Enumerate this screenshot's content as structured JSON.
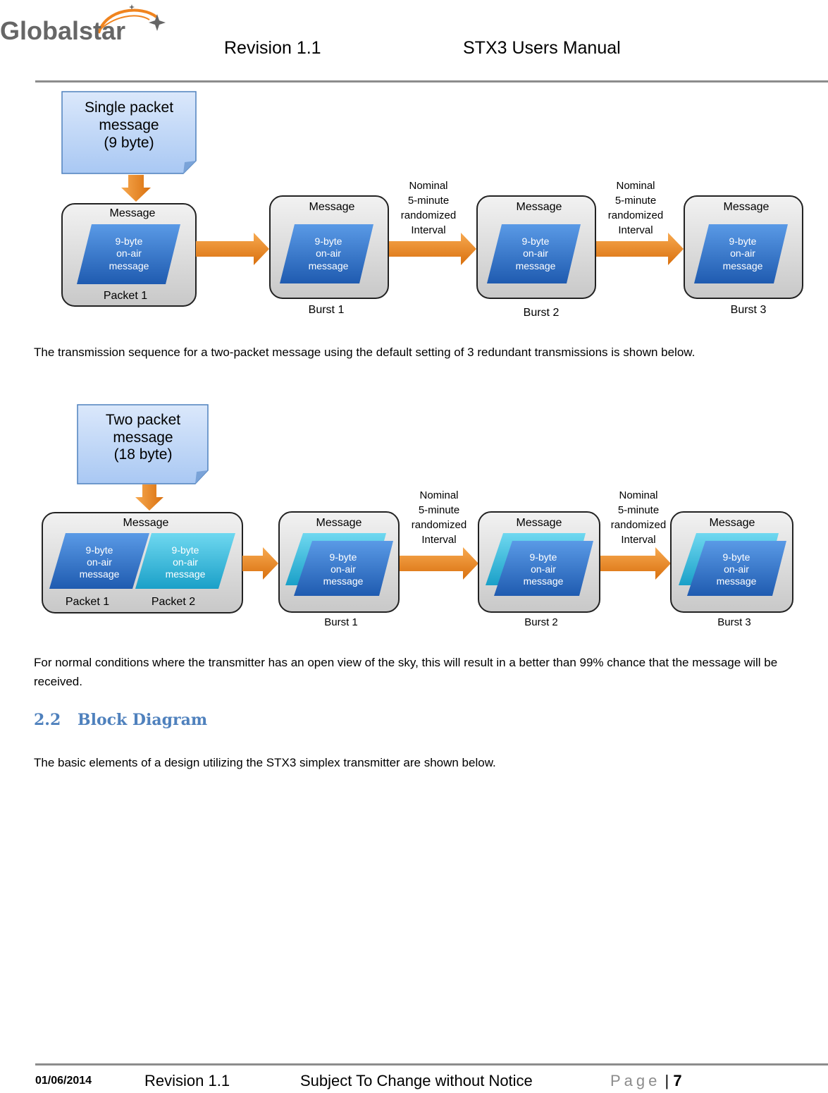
{
  "header": {
    "logo_text": "Globalstar",
    "revision": "Revision 1.1",
    "title": "STX3 Users Manual"
  },
  "diagram1": {
    "note": [
      "Single packet",
      "message",
      "(9 byte)"
    ],
    "source_box": {
      "title": "Message",
      "packets": [
        {
          "label": "Packet 1",
          "text": [
            "9-byte",
            "on-air",
            "message"
          ]
        }
      ]
    },
    "bursts": [
      {
        "title": "Message",
        "label": "Burst 1",
        "text": [
          "9-byte",
          "on-air",
          "message"
        ]
      },
      {
        "title": "Message",
        "label": "Burst 2",
        "text": [
          "9-byte",
          "on-air",
          "message"
        ]
      },
      {
        "title": "Message",
        "label": "Burst 3",
        "text": [
          "9-byte",
          "on-air",
          "message"
        ]
      }
    ],
    "interval_label": [
      "Nominal",
      "5-minute",
      "randomized",
      "Interval"
    ]
  },
  "para1": "The transmission sequence for a two-packet message using the default setting of 3 redundant transmissions is shown below.",
  "diagram2": {
    "note": [
      "Two packet",
      "message",
      "(18 byte)"
    ],
    "source_box": {
      "title": "Message",
      "packets": [
        {
          "label": "Packet 1",
          "text": [
            "9-byte",
            "on-air",
            "message"
          ]
        },
        {
          "label": "Packet 2",
          "text": [
            "9-byte",
            "on-air",
            "message"
          ]
        }
      ]
    },
    "bursts": [
      {
        "title": "Message",
        "label": "Burst 1",
        "text": [
          "9-byte",
          "on-air",
          "message"
        ]
      },
      {
        "title": "Message",
        "label": "Burst 2",
        "text": [
          "9-byte",
          "on-air",
          "message"
        ]
      },
      {
        "title": "Message",
        "label": "Burst 3",
        "text": [
          "9-byte",
          "on-air",
          "message"
        ]
      }
    ],
    "interval_label": [
      "Nominal",
      "5-minute",
      "randomized",
      "Interval"
    ]
  },
  "para2": "For normal conditions where the transmitter has an open view of the sky, this will result in a better than 99% chance that the message will be received.",
  "section": {
    "number": "2.2",
    "title": "Block Diagram"
  },
  "para3": "The basic elements of a design utilizing the STX3 simplex transmitter are shown below.",
  "footer": {
    "date": "01/06/2014",
    "revision": "Revision 1.1",
    "notice": "Subject To Change without Notice",
    "page_label": "Page",
    "page_number": "7"
  },
  "colors": {
    "accent_orange": "#f0841f",
    "packet_blue": "#2f6fc3",
    "packet_cyan": "#2bb5d6",
    "note_blue": "#bcd5f7",
    "heading_blue": "#4f81bd"
  }
}
